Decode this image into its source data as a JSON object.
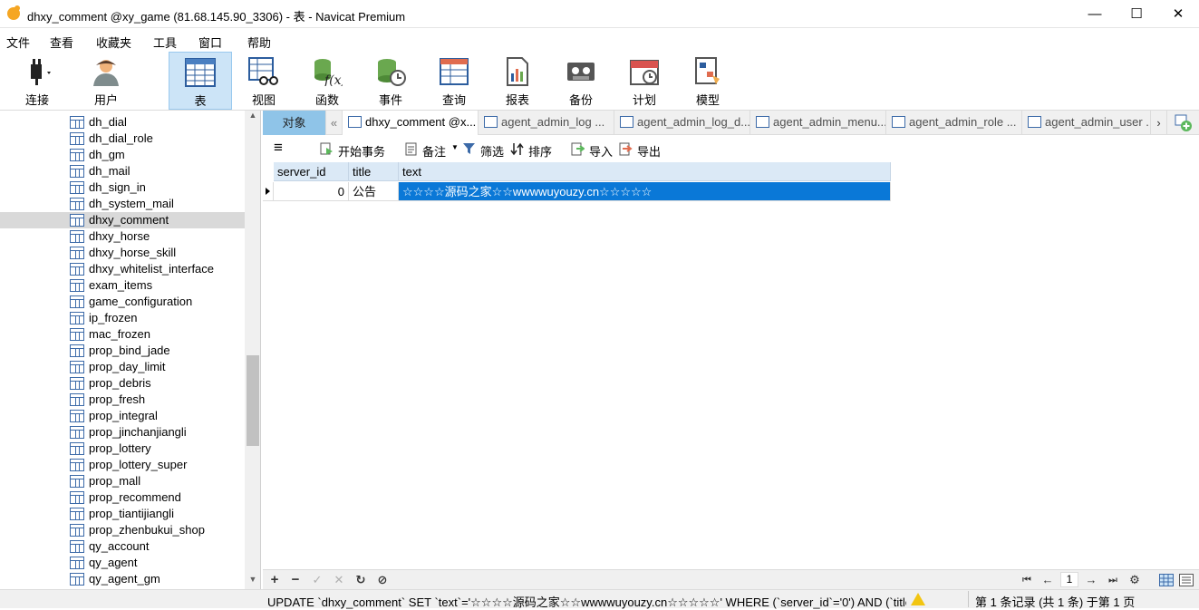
{
  "window": {
    "title": "dhxy_comment @xy_game (81.68.145.90_3306) - 表 - Navicat Premium",
    "min": "—",
    "max": "☐",
    "close": "✕"
  },
  "menu": [
    "文件",
    "查看",
    "收藏夹",
    "工具",
    "窗口",
    "帮助"
  ],
  "toolbar": {
    "connect": "连接",
    "user": "用户",
    "table": "表",
    "view": "视图",
    "function": "函数",
    "event": "事件",
    "query": "查询",
    "report": "报表",
    "backup": "备份",
    "schedule": "计划",
    "model": "模型"
  },
  "sidebar": {
    "items": [
      "dh_dial",
      "dh_dial_role",
      "dh_gm",
      "dh_mail",
      "dh_sign_in",
      "dh_system_mail",
      "dhxy_comment",
      "dhxy_horse",
      "dhxy_horse_skill",
      "dhxy_whitelist_interface",
      "exam_items",
      "game_configuration",
      "ip_frozen",
      "mac_frozen",
      "prop_bind_jade",
      "prop_day_limit",
      "prop_debris",
      "prop_fresh",
      "prop_integral",
      "prop_jinchanjiangli",
      "prop_lottery",
      "prop_lottery_super",
      "prop_mall",
      "prop_recommend",
      "prop_tiantijiangli",
      "prop_zhenbukui_shop",
      "qy_account",
      "qy_agent",
      "qy_agent_gm"
    ],
    "selected": "dhxy_comment"
  },
  "tabs": {
    "objects": "对象",
    "items": [
      "dhxy_comment @x...",
      "agent_admin_log ...",
      "agent_admin_log_d...",
      "agent_admin_menu...",
      "agent_admin_role ...",
      "agent_admin_user ..."
    ]
  },
  "gridtoolbar": {
    "menu": "≡",
    "begin_tx": "开始事务",
    "note": "备注",
    "filter": "筛选",
    "sort": "排序",
    "import": "导入",
    "export": "导出"
  },
  "grid": {
    "columns": [
      "server_id",
      "title",
      "text"
    ],
    "rows": [
      {
        "server_id": "0",
        "title": "公告",
        "text": "☆☆☆☆源码之家☆☆wwwwuyouzy.cn☆☆☆☆☆"
      }
    ]
  },
  "nav": {
    "add": "+",
    "delete": "−",
    "apply": "✓",
    "discard": "✕",
    "refresh": "↻",
    "stop": "⊘",
    "first": "⏮",
    "prev": "←",
    "page": "1",
    "next": "→",
    "last": "⏭",
    "settings": "⚙"
  },
  "status": {
    "sql": "UPDATE `dhxy_comment` SET `text`='☆☆☆☆源码之家☆☆wwwwuyouzy.cn☆☆☆☆☆' WHERE (`server_id`='0') AND (`title`='公",
    "records": "第 1 条记录 (共 1 条) 于第 1 页"
  }
}
